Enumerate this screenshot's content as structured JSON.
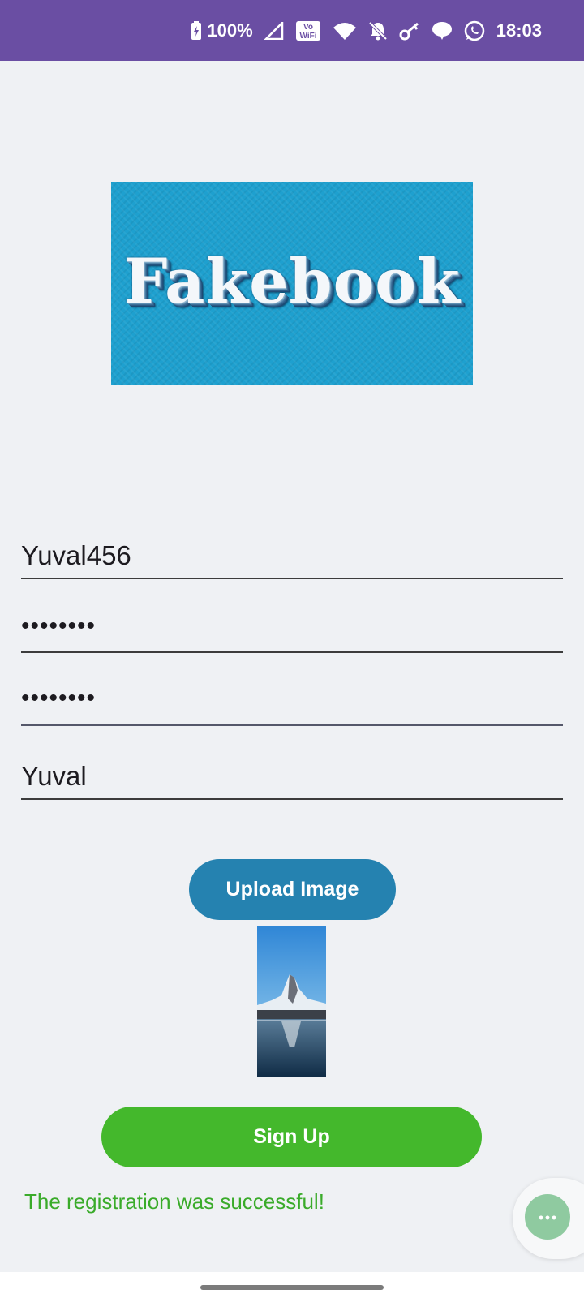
{
  "status_bar": {
    "battery": "100%",
    "time": "18:03",
    "icons": [
      "battery-charging-icon",
      "signal-icon",
      "vowifi-icon",
      "wifi-icon",
      "bell-off-icon",
      "key-icon",
      "chat-bubble-icon",
      "whatsapp-icon"
    ],
    "background_color": "#6a4ea3"
  },
  "logo": {
    "text": "Fakebook",
    "background_color": "#1ea0cf"
  },
  "form": {
    "username_value": "Yuval456",
    "password_value": "••••••••",
    "confirm_password_value": "••••••••",
    "display_name_value": "Yuval"
  },
  "upload_button": {
    "label": "Upload Image",
    "color": "#2582b0"
  },
  "signup_button": {
    "label": "Sign Up",
    "color": "#44b82c"
  },
  "status_message": {
    "text": "The registration was successful!",
    "color": "#3aab2a"
  },
  "floating_button": {
    "icon": "more-horizontal-icon"
  }
}
